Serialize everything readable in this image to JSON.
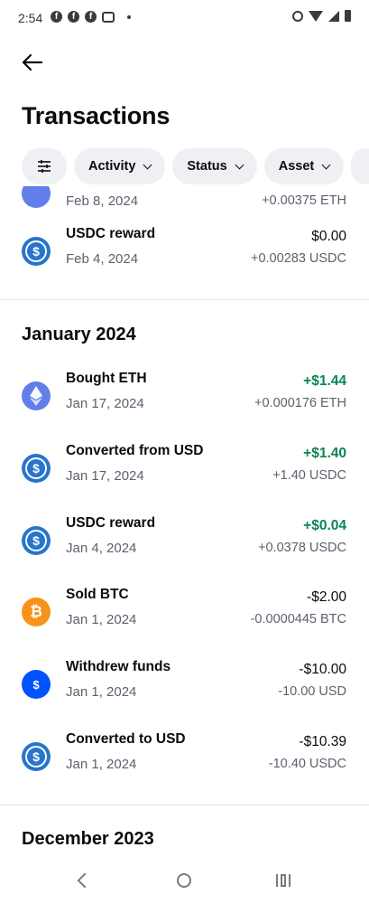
{
  "status": {
    "time": "2:54"
  },
  "header": {
    "title": "Transactions"
  },
  "filters": [
    {
      "label": "Activity"
    },
    {
      "label": "Status"
    },
    {
      "label": "Asset"
    }
  ],
  "partial_row": {
    "date": "Feb 8, 2024",
    "quantity": "+0.00375 ETH"
  },
  "rows": [
    {
      "name": "USDC reward",
      "date": "Feb 4, 2024",
      "amount": "$0.00",
      "quantity": "+0.00283 USDC",
      "icon": "usdc-icon"
    },
    {
      "name": "Bought ETH",
      "date": "Jan 17, 2024",
      "amount": "+$1.44",
      "quantity": "+0.000176 ETH",
      "icon": "eth-icon"
    },
    {
      "name": "Converted from USD",
      "date": "Jan 17, 2024",
      "amount": "+$1.40",
      "quantity": "+1.40 USDC",
      "icon": "usdc-icon"
    },
    {
      "name": "USDC reward",
      "date": "Jan 4, 2024",
      "amount": "+$0.04",
      "quantity": "+0.0378 USDC",
      "icon": "usdc-icon"
    },
    {
      "name": "Sold BTC",
      "date": "Jan 1, 2024",
      "amount": "-$2.00",
      "quantity": "-0.0000445 BTC",
      "icon": "btc-icon"
    },
    {
      "name": "Withdrew funds",
      "date": "Jan 1, 2024",
      "amount": "-$10.00",
      "quantity": "-10.00 USD",
      "icon": "usd-icon"
    },
    {
      "name": "Converted to USD",
      "date": "Jan 1, 2024",
      "amount": "-$10.39",
      "quantity": "-10.40 USDC",
      "icon": "usdc-icon"
    }
  ],
  "sections": {
    "january": "January 2024",
    "december": "December 2023"
  },
  "icons": {
    "usdc": "$",
    "btc": "₿",
    "usd": "$"
  },
  "colors": {
    "positive": "#098551",
    "usdc": "#2775ca",
    "eth": "#627eea",
    "btc": "#f7931a",
    "usd": "#0052ff"
  }
}
